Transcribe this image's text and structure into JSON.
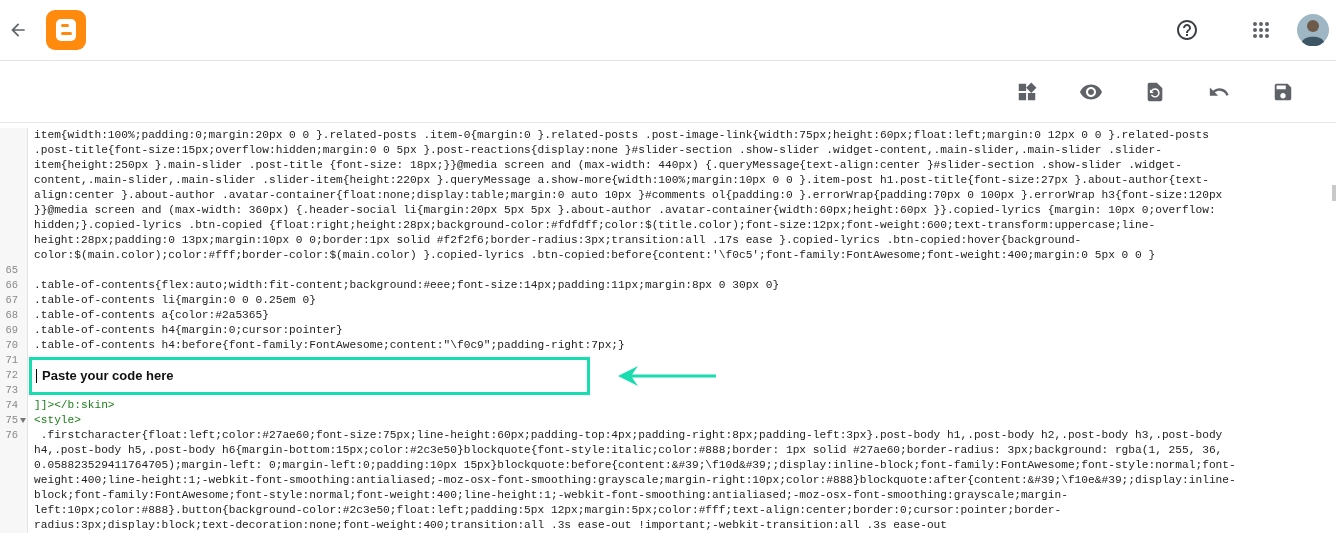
{
  "editor": {
    "lines": [
      {
        "kind": "code",
        "foldable": false,
        "segments": [
          "item{width:100%;padding:0;margin:20px 0 0 }.related-posts .item-0{margin:0 }.related-posts .post-image-link{width:75px;height:60px;float:left;margin:0 12px 0 0 }.related-posts",
          ".post-title{font-size:15px;overflow:hidden;margin:0 0 5px }.post-reactions{display:none }#slider-section .show-slider .widget-content,.main-slider,.main-slider .slider-",
          "item{height:250px }.main-slider .post-title {font-size: 18px;}}@media screen and (max-width: 440px) {.queryMessage{text-align:center }#slider-section .show-slider .widget-",
          "content,.main-slider,.main-slider .slider-item{height:220px }.queryMessage a.show-more{width:100%;margin:10px 0 0 }.item-post h1.post-title{font-size:27px }.about-author{text-",
          "align:center }.about-author .avatar-container{float:none;display:table;margin:0 auto 10px }#comments ol{padding:0 }.errorWrap{padding:70px 0 100px }.errorWrap h3{font-size:120px",
          "}}@media screen and (max-width: 360px) {.header-social li{margin:20px 5px 5px }.about-author .avatar-container{width:60px;height:60px }}.copied-lyrics {margin: 10px 0;overflow:",
          "hidden;}.copied-lyrics .btn-copied {float:right;height:28px;background-color:#fdfdff;color:$(title.color);font-size:12px;font-weight:600;text-transform:uppercase;line-",
          "height:28px;padding:0 13px;margin:10px 0 0;border:1px solid #f2f2f6;border-radius:3px;transition:all .17s ease }.copied-lyrics .btn-copied:hover{background-",
          "color:$(main.color);color:#fff;border-color:$(main.color) }.copied-lyrics .btn-copied:before{content:'\\f0c5';font-family:FontAwesome;font-weight:400;margin:0 5px 0 0 }"
        ]
      },
      {
        "kind": "code",
        "number": "65",
        "foldable": false
      },
      {
        "kind": "code",
        "number": "66",
        "foldable": false,
        "segments": [
          ".table-of-contents{flex:auto;width:fit-content;background:#eee;font-size:14px;padding:11px;margin:8px 0 30px 0}"
        ]
      },
      {
        "kind": "code",
        "number": "67",
        "foldable": false,
        "segments": [
          ".table-of-contents li{margin:0 0 0.25em 0}"
        ]
      },
      {
        "kind": "code",
        "number": "68",
        "foldable": false,
        "segments": [
          ".table-of-contents a{color:#2a5365}"
        ]
      },
      {
        "kind": "code",
        "number": "69",
        "foldable": false,
        "segments": [
          ".table-of-contents h4{margin:0;cursor:pointer}"
        ]
      },
      {
        "kind": "code",
        "number": "70",
        "foldable": false,
        "segments": [
          ".table-of-contents h4:before{font-family:FontAwesome;content:\"\\f0c9\";padding-right:7px;}"
        ]
      },
      {
        "kind": "callout",
        "numbers": [
          "71",
          "72",
          "73"
        ],
        "text": "Paste your code here"
      },
      {
        "kind": "markup",
        "number": "74",
        "foldable": false,
        "segments": [
          "]]></b:skin>"
        ]
      },
      {
        "kind": "markup",
        "number": "75",
        "foldable": true,
        "segments": [
          "<style>"
        ]
      },
      {
        "kind": "code",
        "number": "76",
        "foldable": false,
        "segments": [
          " .firstcharacter{float:left;color:#27ae60;font-size:75px;line-height:60px;padding-top:4px;padding-right:8px;padding-left:3px}.post-body h1,.post-body h2,.post-body h3,.post-body",
          "h4,.post-body h5,.post-body h6{margin-bottom:15px;color:#2c3e50}blockquote{font-style:italic;color:#888;border: 1px solid #27ae60;border-radius: 3px;background: rgba(1, 255, 36,",
          "0.058823529411764705);margin-left: 0;margin-left:0;padding:10px 15px}blockquote:before{content:&#39;\\f10d&#39;;display:inline-block;font-family:FontAwesome;font-style:normal;font-",
          "weight:400;line-height:1;-webkit-font-smoothing:antialiased;-moz-osx-font-smoothing:grayscale;margin-right:10px;color:#888}blockquote:after{content:&#39;\\f10e&#39;;display:inline-",
          "block;font-family:FontAwesome;font-style:normal;font-weight:400;line-height:1;-webkit-font-smoothing:antialiased;-moz-osx-font-smoothing:grayscale;margin-",
          "left:10px;color:#888}.button{background-color:#2c3e50;float:left;padding:5px 12px;margin:5px;color:#fff;text-align:center;border:0;cursor:pointer;border-",
          "radius:3px;display:block;text-decoration:none;font-weight:400;transition:all .3s ease-out !important;-webkit-transition:all .3s ease-out"
        ]
      }
    ]
  }
}
